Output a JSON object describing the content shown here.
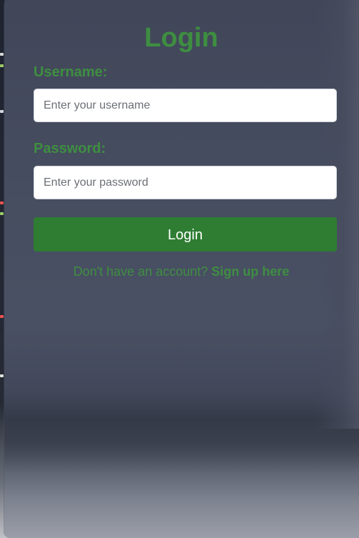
{
  "login": {
    "title": "Login",
    "username_label": "Username:",
    "username_placeholder": "Enter your username",
    "username_value": "",
    "password_label": "Password:",
    "password_placeholder": "Enter your password",
    "password_value": "",
    "submit_label": "Login",
    "signup_prompt": "Don't have an account?",
    "signup_link": "Sign up here"
  },
  "colors": {
    "accent_green": "#3e8e41",
    "button_green": "#2e7d32",
    "overlay": "#4a5064"
  }
}
